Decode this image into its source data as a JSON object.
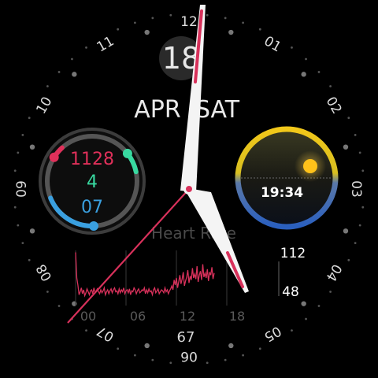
{
  "watch": {
    "bezel_numbers": [
      "12",
      "01",
      "02",
      "03",
      "04",
      "05",
      "06",
      "07",
      "08",
      "09",
      "10",
      "11"
    ],
    "day_of_month": "18",
    "month": "APR",
    "weekday": "SAT",
    "activity": {
      "steps": "1128",
      "activity_value": "4",
      "stand_value": "07",
      "colors": {
        "steps": "#e0305a",
        "activity": "#38d9a0",
        "stand": "#3aa0e0"
      }
    },
    "sun": {
      "time": "19:34",
      "ring_colors": [
        "#f2c81a",
        "#2a5fbf"
      ]
    },
    "heart_rate": {
      "title": "Heart Rate",
      "max": "112",
      "min": "48",
      "current": "67",
      "x_ticks": [
        "00",
        "06",
        "12",
        "18"
      ],
      "samples": [
        92,
        118,
        125,
        135,
        132,
        128,
        134,
        130,
        136,
        133,
        129,
        132,
        135,
        131,
        130,
        134,
        128,
        133,
        131,
        129,
        132,
        134,
        130,
        133,
        131,
        128,
        135,
        132,
        130,
        134,
        131,
        129,
        133,
        130,
        128,
        132,
        131,
        134,
        129,
        133,
        130,
        132,
        128,
        134,
        131,
        130,
        133,
        129,
        135,
        131,
        132,
        128,
        130,
        134,
        131,
        129,
        133,
        132,
        130,
        131,
        128,
        134,
        130,
        133,
        129,
        132,
        131,
        135,
        130,
        128,
        133,
        131,
        129,
        134,
        132,
        130,
        131,
        133,
        128,
        132,
        130,
        134,
        131,
        129,
        126,
        130,
        120,
        125,
        118,
        128,
        122,
        115,
        124,
        119,
        112,
        126,
        121,
        117,
        110,
        123,
        116,
        120,
        108,
        118,
        114,
        119,
        106,
        122,
        115,
        111,
        120,
        104,
        117,
        113,
        118,
        109,
        121,
        112,
        115,
        107,
        119,
        113
      ]
    },
    "hands": {
      "hour": "5:03",
      "minute": "0:00",
      "second": "7:10"
    },
    "accent": "#d8315b"
  }
}
